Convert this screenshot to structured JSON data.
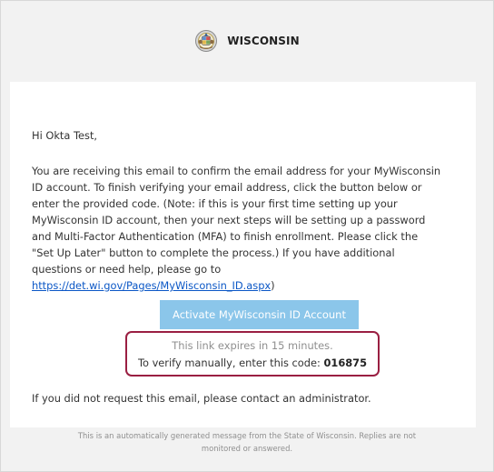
{
  "header": {
    "brand_name": "WISCONSIN",
    "seal_icon": "wisconsin-state-seal-icon"
  },
  "email": {
    "greeting": "Hi Okta Test,",
    "body_lines": [
      "You are receiving this email to confirm the email address for your MyWisconsin",
      "ID account. To finish verifying your email address, click the button below or",
      "enter the provided code. (Note: if this is your first time setting up your",
      "MyWisconsin ID account, then your next steps will be setting up a password",
      "and Multi-Factor Authentication (MFA) to finish enrollment. Please click the",
      "\"Set Up Later\" button to complete the process.) If you have additional",
      "questions or need help, please go to"
    ],
    "help_link": "https://det.wi.gov/Pages/MyWisconsin_ID.aspx",
    "help_link_suffix": ")",
    "activate_button_label": "Activate MyWisconsin ID Account",
    "expiry_text": "This link expires in 15 minutes.",
    "manual_prefix": "To verify manually, enter this code: ",
    "verification_code": "016875",
    "no_request_text": "If you did not request this email, please contact an administrator."
  },
  "footer": {
    "lines": [
      "This is an automatically generated message from the State of Wisconsin. Replies are not",
      "monitored or answered."
    ]
  },
  "colors": {
    "frame_background": "#f2f2f2",
    "card_background": "#ffffff",
    "button_background": "#8bc6ea",
    "highlight_border": "#9a1f42",
    "link": "#0b57c6",
    "muted_text": "#8f8f8f"
  }
}
